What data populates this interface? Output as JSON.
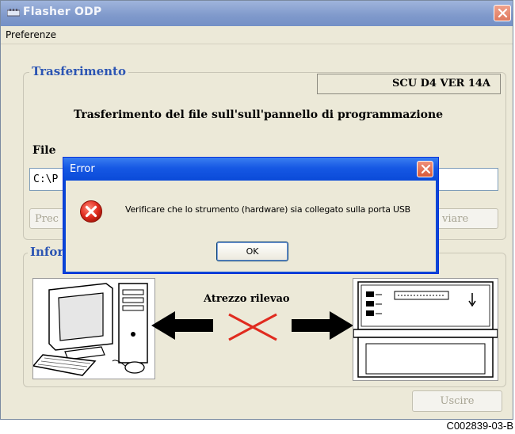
{
  "window": {
    "title": "Flasher ODP"
  },
  "menu": {
    "items": [
      "Preferenze"
    ]
  },
  "transfer": {
    "group_label": "Trasferimento",
    "version": "SCU D4 VER  14A",
    "heading": "Trasferimento del file sull'sull'pannello di programmazione",
    "file_label": "File",
    "file_value": "C:\\P",
    "button_left_partial": "Prec",
    "button_right_partial": "viare"
  },
  "info": {
    "group_label": "Infor",
    "status_text": "Atrezzo rilevao"
  },
  "footer": {
    "exit_button": "Uscire"
  },
  "error_dialog": {
    "title": "Error",
    "message": "Verificare che lo strumento (hardware) sia collegato sulla porta USB",
    "ok_button": "OK",
    "icon": "error-icon"
  },
  "caption": "C002839-03-B",
  "colors": {
    "title_bar": "#7f99cb",
    "dialog_blue": "#0a46d6",
    "group_label": "#2c55b3",
    "close_red": "#df7a5f",
    "error_red": "#e02b1f",
    "cross_red": "#e02b1f"
  }
}
